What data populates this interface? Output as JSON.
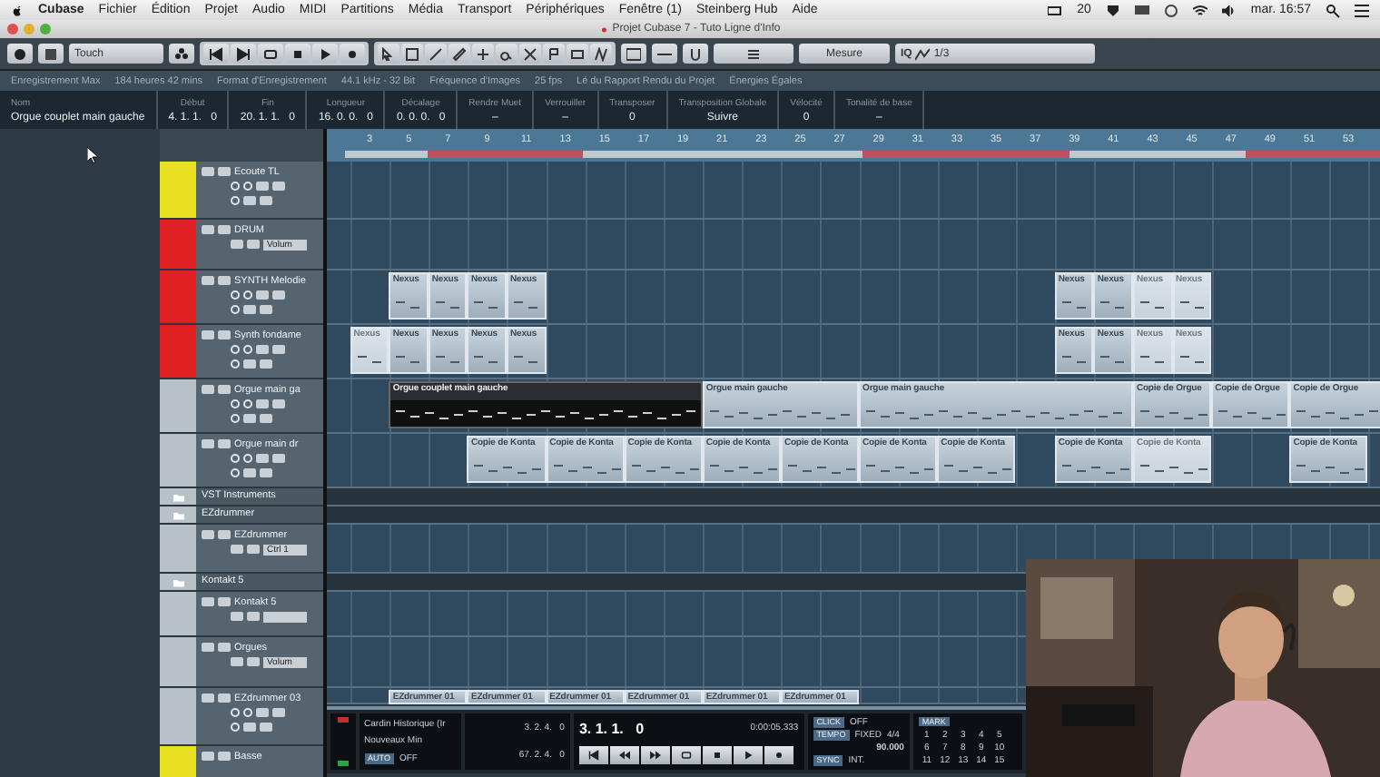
{
  "menubar": {
    "app": "Cubase",
    "items": [
      "Fichier",
      "Édition",
      "Projet",
      "Audio",
      "MIDI",
      "Partitions",
      "Média",
      "Transport",
      "Périphériques",
      "Fenêtre (1)",
      "Steinberg Hub",
      "Aide"
    ],
    "badge": "20",
    "clock": "mar. 16:57"
  },
  "window": {
    "title": "Projet Cubase 7 - Tuto Ligne d'Info"
  },
  "toolbar": {
    "automation_mode": "Touch",
    "grid_type": "Mesure",
    "quantize_label": "IQ",
    "quantize": "1/3"
  },
  "status_line": [
    "Enregistrement Max",
    "184 heures 42 mins",
    "Format d'Enregistrement",
    "44.1 kHz - 32 Bit",
    "Fréquence d'Images",
    "25 fps",
    "Lé du Rapport Rendu du Projet",
    "Énergies Égales"
  ],
  "info_line": [
    {
      "label": "Nom",
      "value": "Orgue couplet main gauche"
    },
    {
      "label": "Début",
      "value": "4. 1. 1.   0"
    },
    {
      "label": "Fin",
      "value": "20. 1. 1.   0"
    },
    {
      "label": "Longueur",
      "value": "16. 0. 0.   0"
    },
    {
      "label": "Décalage",
      "value": "0. 0. 0.   0"
    },
    {
      "label": "Rendre Muet",
      "value": "–"
    },
    {
      "label": "Verrouiller",
      "value": "–"
    },
    {
      "label": "Transposer",
      "value": "0"
    },
    {
      "label": "Transposition Globale",
      "value": "Suivre"
    },
    {
      "label": "Vélocité",
      "value": "0"
    },
    {
      "label": "Tonalité de base",
      "value": "–"
    }
  ],
  "ruler": {
    "bars": [
      "3",
      "5",
      "7",
      "9",
      "11",
      "13",
      "15",
      "17",
      "19",
      "21",
      "23",
      "25",
      "27",
      "29",
      "31",
      "33",
      "35",
      "37",
      "39",
      "41",
      "43",
      "45",
      "47",
      "49",
      "51",
      "53"
    ]
  },
  "tracks": [
    {
      "name": "Ecoute TL",
      "kind": "instrument",
      "color": "#e8e020"
    },
    {
      "name": "DRUM",
      "kind": "channel",
      "color": "#e02020",
      "field": "Volum"
    },
    {
      "name": "SYNTH Melodie",
      "kind": "instrument",
      "color": "#e02020",
      "parts": [
        {
          "name": "Nexus",
          "selected": false,
          "muted": false
        },
        {
          "name": "Nexus",
          "selected": false,
          "muted": false
        },
        {
          "name": "Nexus",
          "selected": false,
          "muted": false
        },
        {
          "name": "Nexus",
          "selected": false,
          "muted": false
        },
        {
          "name": "Nexus",
          "selected": false,
          "muted": false
        },
        {
          "name": "Nexus",
          "selected": false,
          "muted": false
        },
        {
          "name": "Nexus",
          "selected": false,
          "muted": true
        },
        {
          "name": "Nexus",
          "selected": false,
          "muted": true
        }
      ]
    },
    {
      "name": "Synth fondame",
      "kind": "instrument",
      "color": "#e02020",
      "parts": [
        {
          "name": "Nexus",
          "selected": false,
          "muted": true
        },
        {
          "name": "Nexus",
          "selected": false,
          "muted": false
        },
        {
          "name": "Nexus",
          "selected": false,
          "muted": false
        },
        {
          "name": "Nexus",
          "selected": false,
          "muted": false
        },
        {
          "name": "Nexus",
          "selected": false,
          "muted": false
        },
        {
          "name": "Nexus",
          "selected": false,
          "muted": false
        },
        {
          "name": "Nexus",
          "selected": false,
          "muted": false
        },
        {
          "name": "Nexus",
          "selected": false,
          "muted": true
        },
        {
          "name": "Nexus",
          "selected": false,
          "muted": true
        }
      ]
    },
    {
      "name": "Orgue main ga",
      "kind": "instrument",
      "color": "#b8c0c8",
      "parts": [
        {
          "name": "Orgue couplet main gauche",
          "selected": true,
          "muted": false
        },
        {
          "name": "Orgue main gauche",
          "selected": false,
          "muted": false
        },
        {
          "name": "Orgue main gauche",
          "selected": false,
          "muted": false
        },
        {
          "name": "Copie de Orgue",
          "selected": false,
          "muted": false
        },
        {
          "name": "Copie de Orgue",
          "selected": false,
          "muted": false
        },
        {
          "name": "Copie de Orgue",
          "selected": false,
          "muted": false
        }
      ]
    },
    {
      "name": "Orgue main dr",
      "kind": "instrument",
      "color": "#b8c0c8",
      "parts": [
        {
          "name": "Copie de Konta",
          "selected": false,
          "muted": false
        },
        {
          "name": "Copie de Konta",
          "selected": false,
          "muted": false
        },
        {
          "name": "Copie de Konta",
          "selected": false,
          "muted": false
        },
        {
          "name": "Copie de Konta",
          "selected": false,
          "muted": false
        },
        {
          "name": "Copie de Konta",
          "selected": false,
          "muted": false
        },
        {
          "name": "Copie de Konta",
          "selected": false,
          "muted": false
        },
        {
          "name": "Copie de Konta",
          "selected": false,
          "muted": false
        },
        {
          "name": "Copie de Konta",
          "selected": false,
          "muted": false
        },
        {
          "name": "Copie de Konta",
          "selected": false,
          "muted": true
        },
        {
          "name": "Copie de Konta",
          "selected": false,
          "muted": false
        }
      ]
    },
    {
      "name": "VST Instruments",
      "kind": "folder",
      "color": "#b8c0c8"
    },
    {
      "name": "EZdrummer",
      "kind": "folder",
      "color": "#b8c0c8"
    },
    {
      "name": "EZdrummer",
      "kind": "channel",
      "color": "#b8c0c8",
      "field": "Ctrl 1"
    },
    {
      "name": "Kontakt 5",
      "kind": "folder",
      "color": "#b8c0c8"
    },
    {
      "name": "Kontakt 5",
      "kind": "channel",
      "color": "#b8c0c8"
    },
    {
      "name": "Orgues",
      "kind": "channel",
      "color": "#b8c0c8",
      "field": "Volum"
    },
    {
      "name": "EZdrummer 03",
      "kind": "instrument",
      "color": "#b8c0c8",
      "parts": [
        {
          "name": "EZdrummer 01",
          "selected": false,
          "muted": false
        },
        {
          "name": "EZdrummer 01",
          "selected": false,
          "muted": false
        },
        {
          "name": "EZdrummer 01",
          "selected": false,
          "muted": false
        },
        {
          "name": "EZdrummer 01",
          "selected": false,
          "muted": false
        },
        {
          "name": "EZdrummer 01",
          "selected": false,
          "muted": false
        },
        {
          "name": "EZdrummer 01",
          "selected": false,
          "muted": false
        }
      ]
    },
    {
      "name": "Basse",
      "kind": "instrument",
      "color": "#e8e020"
    }
  ],
  "transport": {
    "preroll_mode": "Cardin Historique (Ir",
    "record_mode": "Nouveaux Min",
    "auto_quantize": "AUTO",
    "auto_quantize_state": "OFF",
    "left_locator": "3. 2. 4.   0",
    "right_locator": "67. 2. 4.   0",
    "position": "3. 1. 1.   0",
    "time": "0:00:05.333",
    "click_label": "CLICK",
    "click_state": "OFF",
    "tempo_label": "TEMPO",
    "tempo_mode": "FIXED",
    "signature": "4/4",
    "tempo": "90.000",
    "sync_label": "SYNC",
    "sync_state": "INT.",
    "marker_label": "MARK",
    "markers": [
      "1",
      "2",
      "3",
      "4",
      "5",
      "6",
      "7",
      "8",
      "9",
      "10",
      "11",
      "12",
      "13",
      "14",
      "15"
    ]
  }
}
